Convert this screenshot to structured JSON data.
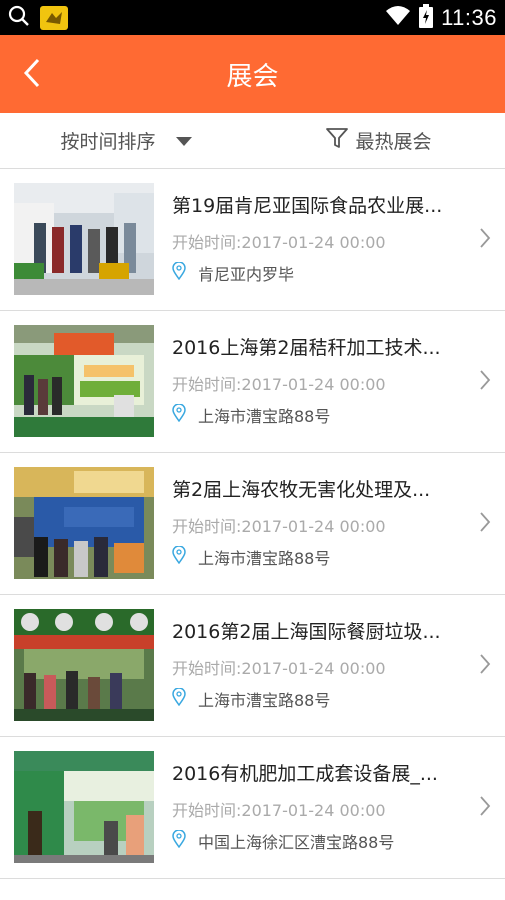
{
  "status_bar": {
    "time": "11:36",
    "icons": [
      "search-icon",
      "app-notification-icon",
      "wifi-icon",
      "battery-icon"
    ]
  },
  "header": {
    "title": "展会",
    "back_icon": "chevron-left-icon"
  },
  "filters": {
    "sort_label": "按时间排序",
    "hot_label": "最热展会"
  },
  "colors": {
    "accent": "#ff6a33",
    "location_icon": "#3aa8e0"
  },
  "exhibitions": [
    {
      "title": "第19届肯尼亚国际食品农业展...",
      "time": "开始时间:2017-01-24 00:00",
      "location": "肯尼亚内罗毕"
    },
    {
      "title": "2016上海第2届秸秆加工技术...",
      "time": "开始时间:2017-01-24 00:00",
      "location": "上海市漕宝路88号"
    },
    {
      "title": "第2届上海农牧无害化处理及...",
      "time": "开始时间:2017-01-24 00:00",
      "location": "上海市漕宝路88号"
    },
    {
      "title": "2016第2届上海国际餐厨垃圾...",
      "time": "开始时间:2017-01-24 00:00",
      "location": "上海市漕宝路88号"
    },
    {
      "title": "2016有机肥加工成套设备展_...",
      "time": "开始时间:2017-01-24 00:00",
      "location": "中国上海徐汇区漕宝路88号"
    }
  ]
}
